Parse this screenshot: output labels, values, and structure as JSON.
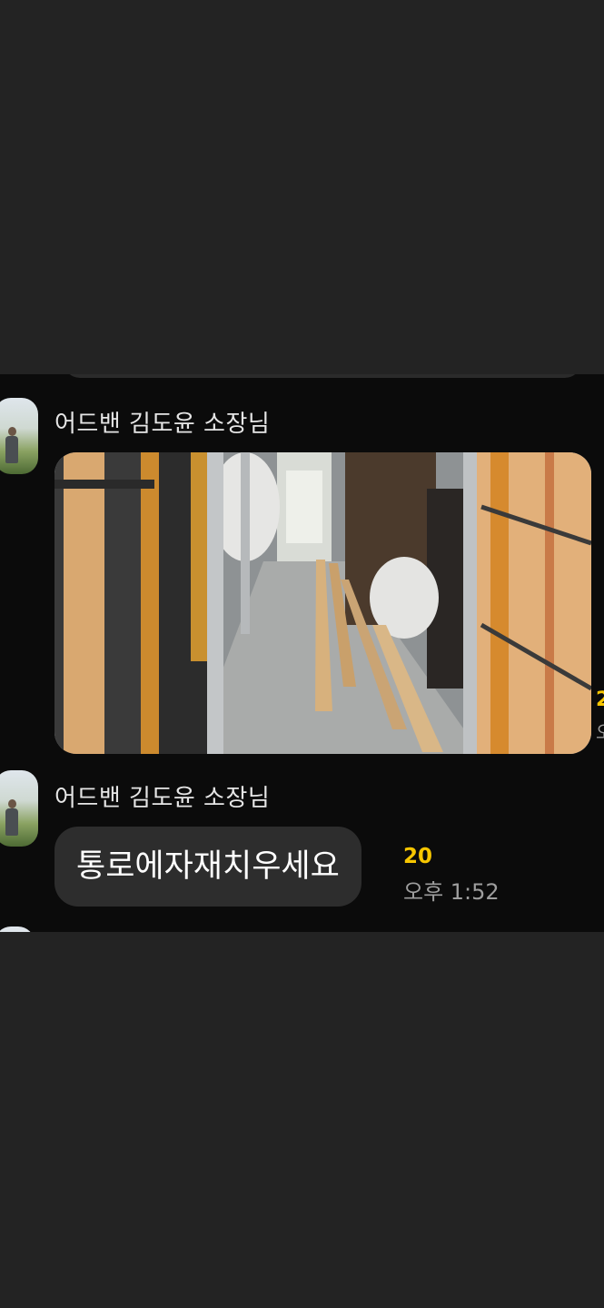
{
  "messages": [
    {
      "sender": "어드밴 김도윤 소장님",
      "type": "image"
    },
    {
      "sender": "어드밴 김도윤 소장님",
      "type": "text",
      "text": "통로에자재치우세요",
      "unread": "20",
      "time": "오후 1:52"
    }
  ],
  "icons": {
    "avatar": "profile-photo",
    "photo": "construction-site-photo"
  },
  "colors": {
    "unread": "#f7c600",
    "bubble": "#2d2d2d",
    "background": "#0b0b0b"
  }
}
